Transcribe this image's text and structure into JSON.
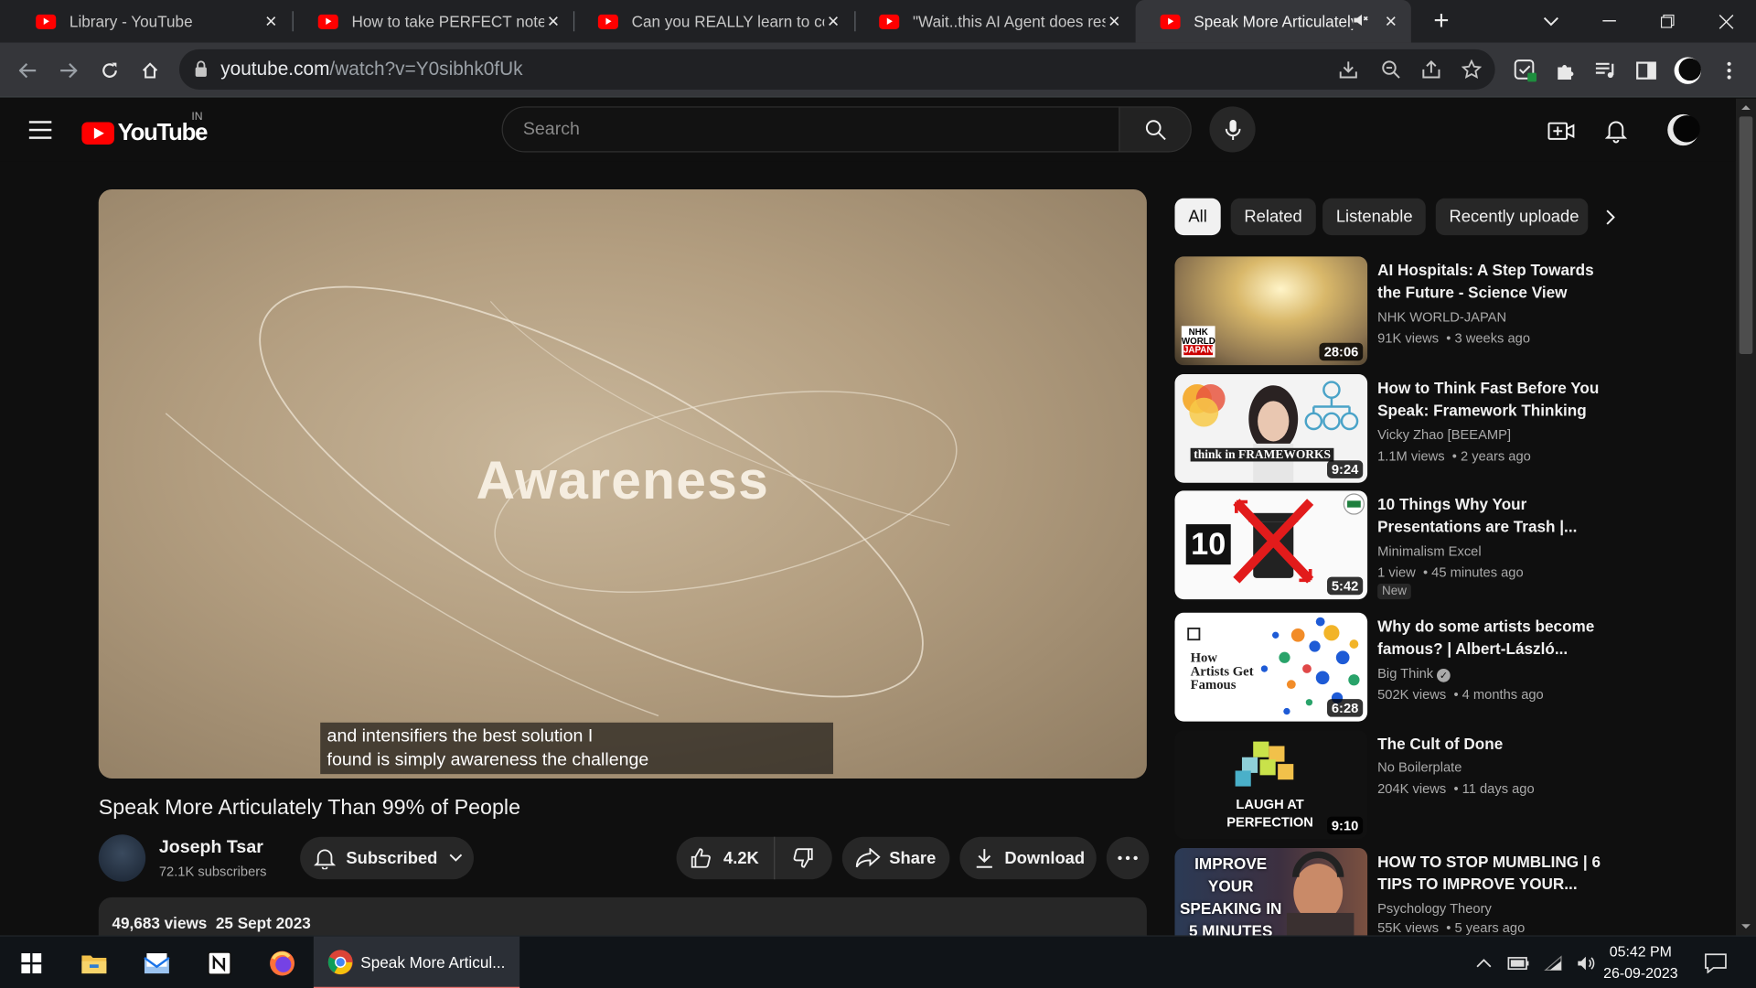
{
  "browser": {
    "tabs": [
      {
        "title": "Library - YouTube"
      },
      {
        "title": "How to take PERFECT notes w"
      },
      {
        "title": "Can you REALLY learn to code"
      },
      {
        "title": "\"Wait..this AI Agent does rese"
      },
      {
        "title": "Speak More Articulately T"
      }
    ],
    "url_host": "youtube.com",
    "url_path": "/watch?v=Y0sibhk0fUk"
  },
  "youtube": {
    "logo_text": "YouTube",
    "country_code": "IN",
    "search_placeholder": "Search"
  },
  "player": {
    "frame_text": "Awareness",
    "caption_line1": "and intensifiers the best solution I",
    "caption_line2": "found is simply awareness the challenge"
  },
  "video": {
    "title": "Speak More Articulately Than 99% of People",
    "channel": "Joseph Tsar",
    "subscribers": "72.1K subscribers",
    "subscribed_label": "Subscribed",
    "likes": "4.2K",
    "share_label": "Share",
    "download_label": "Download",
    "views": "49,683 views",
    "date": "25 Sept 2023"
  },
  "chips": [
    "All",
    "Related",
    "Listenable",
    "Recently uploade"
  ],
  "recommendations": [
    {
      "title": "AI Hospitals: A Step Towards the Future - Science View",
      "channel": "NHK WORLD-JAPAN",
      "views": "91K views",
      "age": "3 weeks ago",
      "duration": "28:06",
      "thumb_text": "NHK WORLD JAPAN"
    },
    {
      "title": "How to Think Fast Before You Speak: Framework Thinking",
      "channel": "Vicky Zhao [BEEAMP]",
      "views": "1.1M views",
      "age": "2 years ago",
      "duration": "9:24",
      "thumb_text": "think in FRAMEWORKS"
    },
    {
      "title": "10 Things Why Your Presentations are Trash |...",
      "channel": "Minimalism Excel",
      "views": "1 view",
      "age": "45 minutes ago",
      "duration": "5:42",
      "badge": "New",
      "thumb_text": "10"
    },
    {
      "title": "Why do some artists become famous? | Albert-László...",
      "channel": "Big Think",
      "views": "502K views",
      "age": "4 months ago",
      "duration": "6:28",
      "thumb_text": "How Artists Get Famous"
    },
    {
      "title": "The Cult of Done",
      "channel": "No Boilerplate",
      "views": "204K views",
      "age": "11 days ago",
      "duration": "9:10",
      "thumb_text": "LAUGH AT PERFECTION"
    },
    {
      "title": "HOW TO STOP MUMBLING | 6 TIPS TO IMPROVE YOUR...",
      "channel": "Psychology Theory",
      "views": "55K views",
      "age": "5 years ago",
      "thumb_text": "IMPROVE YOUR SPEAKING IN 5 MINUTES"
    }
  ],
  "taskbar": {
    "active_window": "Speak More Articul...",
    "time": "05:42 PM",
    "date": "26-09-2023"
  }
}
